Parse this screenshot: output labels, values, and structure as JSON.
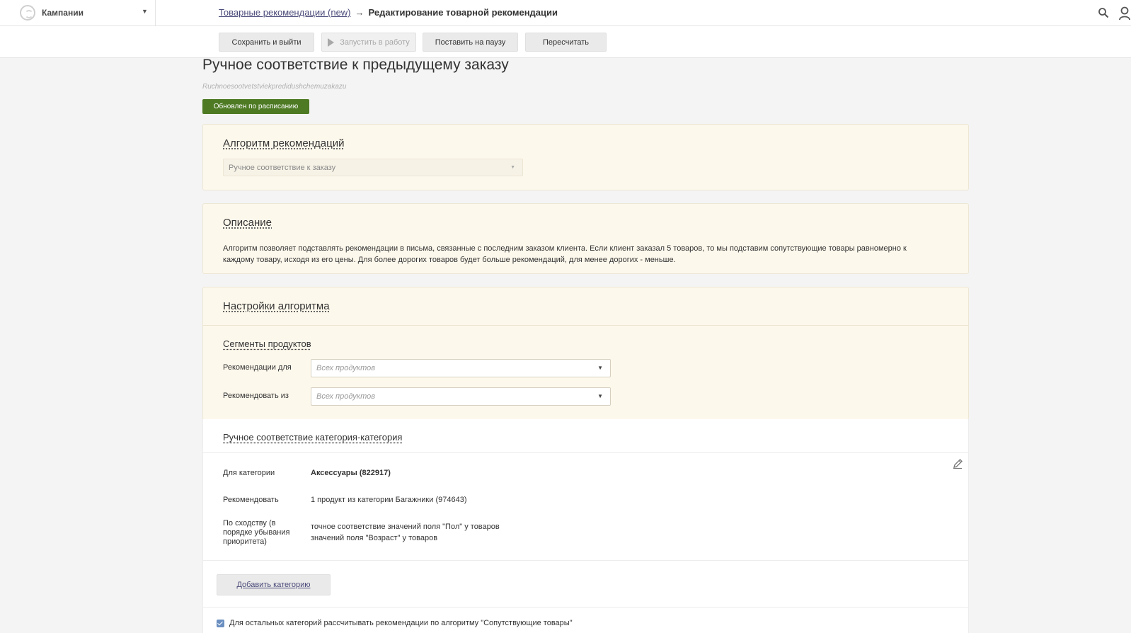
{
  "header": {
    "campaign_label": "Кампании",
    "breadcrumb_link": "Товарные рекомендации (new)",
    "breadcrumb_arrow": "→",
    "breadcrumb_current": "Редактирование товарной рекомендации"
  },
  "toolbar": {
    "save_exit": "Сохранить и выйти",
    "start": "Запустить в работу",
    "pause": "Поставить на паузу",
    "recalc": "Пересчитать"
  },
  "page": {
    "title": "Ручное соответствие к предыдущему заказу",
    "slug": "Ruchnoesootvetstviekpredidushchemuzakazu",
    "status": "Обновлен по расписанию"
  },
  "algorithm": {
    "title": "Алгоритм рекомендаций",
    "selected": "Ручное соответствие к заказу"
  },
  "description": {
    "title": "Описание",
    "text": "Алгоритм позволяет подставлять рекомендации в письма, связанные с последним заказом клиента. Если клиент заказал 5 товаров, то мы подставим сопутствующие товары равномерно к каждому товару, исходя из его цены. Для более дорогих товаров будет больше рекомендаций, для менее дорогих - меньше."
  },
  "settings": {
    "title": "Настройки алгоритма",
    "segments_title": "Сегменты продуктов",
    "rec_for_label": "Рекомендации для",
    "rec_for_value": "Всех продуктов",
    "rec_from_label": "Рекомендовать из",
    "rec_from_value": "Всех продуктов"
  },
  "manual": {
    "title": "Ручное соответствие категория-категория",
    "category_label": "Для категории",
    "category_value": "Аксессуары (822917)",
    "recommend_label": "Рекомендовать",
    "recommend_value": "1 продукт из категории Багажники (974643)",
    "similarity_label": "По сходству (в порядке убывания приоритета)",
    "similarity_line1": "точное соответствие значений поля \"Пол\" у товаров",
    "similarity_line2": "значений поля \"Возраст\" у товаров",
    "add_category": "Добавить категорию",
    "other_categories": "Для остальных категорий рассчитывать рекомендации по алгоритму \"Сопутствующие товары\""
  }
}
